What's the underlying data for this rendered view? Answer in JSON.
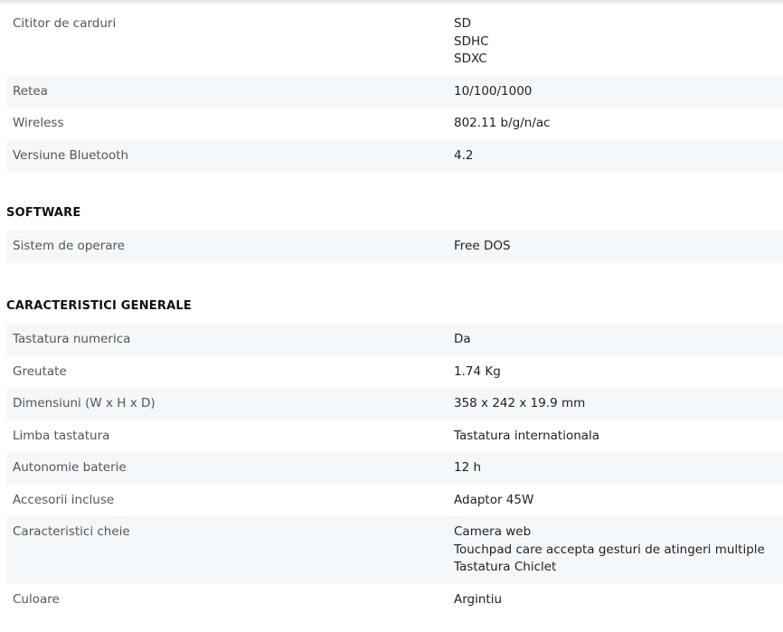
{
  "groups": [
    {
      "heading": "",
      "rows": [
        {
          "label": "Cititor de carduri",
          "values": [
            "SD",
            "SDHC",
            "SDXC"
          ]
        },
        {
          "label": "Retea",
          "values": [
            "10/100/1000"
          ]
        },
        {
          "label": "Wireless",
          "values": [
            "802.11 b/g/n/ac"
          ]
        },
        {
          "label": "Versiune Bluetooth",
          "values": [
            "4.2"
          ]
        }
      ]
    },
    {
      "heading": "SOFTWARE",
      "rows": [
        {
          "label": "Sistem de operare",
          "values": [
            "Free DOS"
          ]
        }
      ]
    },
    {
      "heading": "CARACTERISTICI GENERALE",
      "rows": [
        {
          "label": "Tastatura numerica",
          "values": [
            "Da"
          ]
        },
        {
          "label": "Greutate",
          "values": [
            "1.74 Kg"
          ]
        },
        {
          "label": "Dimensiuni (W x H x D)",
          "values": [
            "358 x 242 x 19.9 mm"
          ]
        },
        {
          "label": "Limba tastatura",
          "values": [
            "Tastatura internationala"
          ]
        },
        {
          "label": "Autonomie baterie",
          "values": [
            "12 h"
          ]
        },
        {
          "label": "Accesorii incluse",
          "values": [
            "Adaptor 45W"
          ]
        },
        {
          "label": "Caracteristici cheie",
          "values": [
            "Camera web",
            "Touchpad care accepta gesturi de atingeri multiple",
            "Tastatura Chiclet"
          ]
        },
        {
          "label": "Culoare",
          "values": [
            "Argintiu"
          ]
        }
      ]
    }
  ]
}
